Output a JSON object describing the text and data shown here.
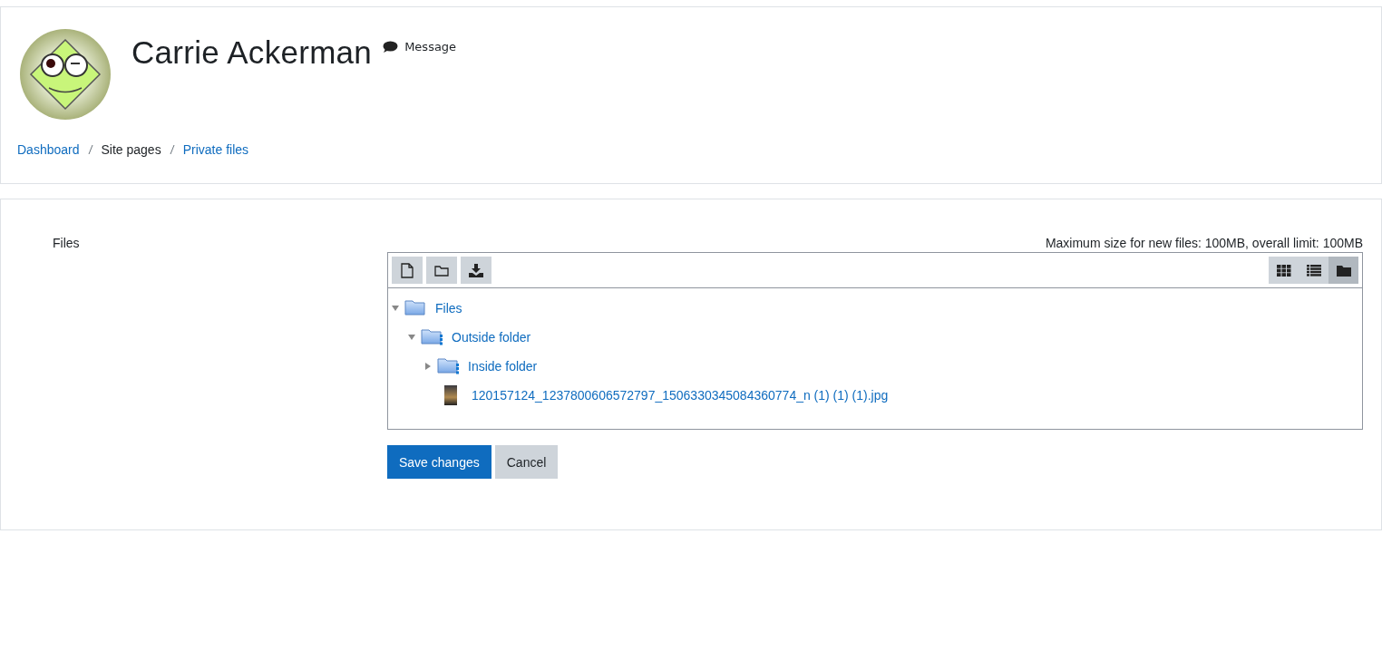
{
  "header": {
    "name": "Carrie Ackerman",
    "message_link": "Message"
  },
  "breadcrumb": [
    {
      "label": "Dashboard",
      "link": true
    },
    {
      "label": "Site pages",
      "link": false
    },
    {
      "label": "Private files",
      "link": true
    }
  ],
  "form": {
    "field_label": "Files",
    "limits": "Maximum size for new files: 100MB, overall limit: 100MB",
    "view_modes": [
      {
        "kind": "icons",
        "selected": false
      },
      {
        "kind": "list",
        "selected": false
      },
      {
        "kind": "tree",
        "selected": true
      }
    ],
    "tree": [
      {
        "kind": "folder",
        "label": "Files",
        "expanded": true,
        "children": [
          {
            "kind": "folder",
            "label": "Outside folder",
            "expanded": true,
            "children": [
              {
                "kind": "folder",
                "label": "Inside folder",
                "expanded": false
              },
              {
                "kind": "file",
                "label": "120157124_1237800606572797_1506330345084360774_n (1) (1) (1).jpg"
              }
            ]
          }
        ]
      }
    ],
    "buttons": [
      {
        "label": "Save changes",
        "kind": "primary"
      },
      {
        "label": "Cancel",
        "kind": "secondary"
      }
    ]
  }
}
